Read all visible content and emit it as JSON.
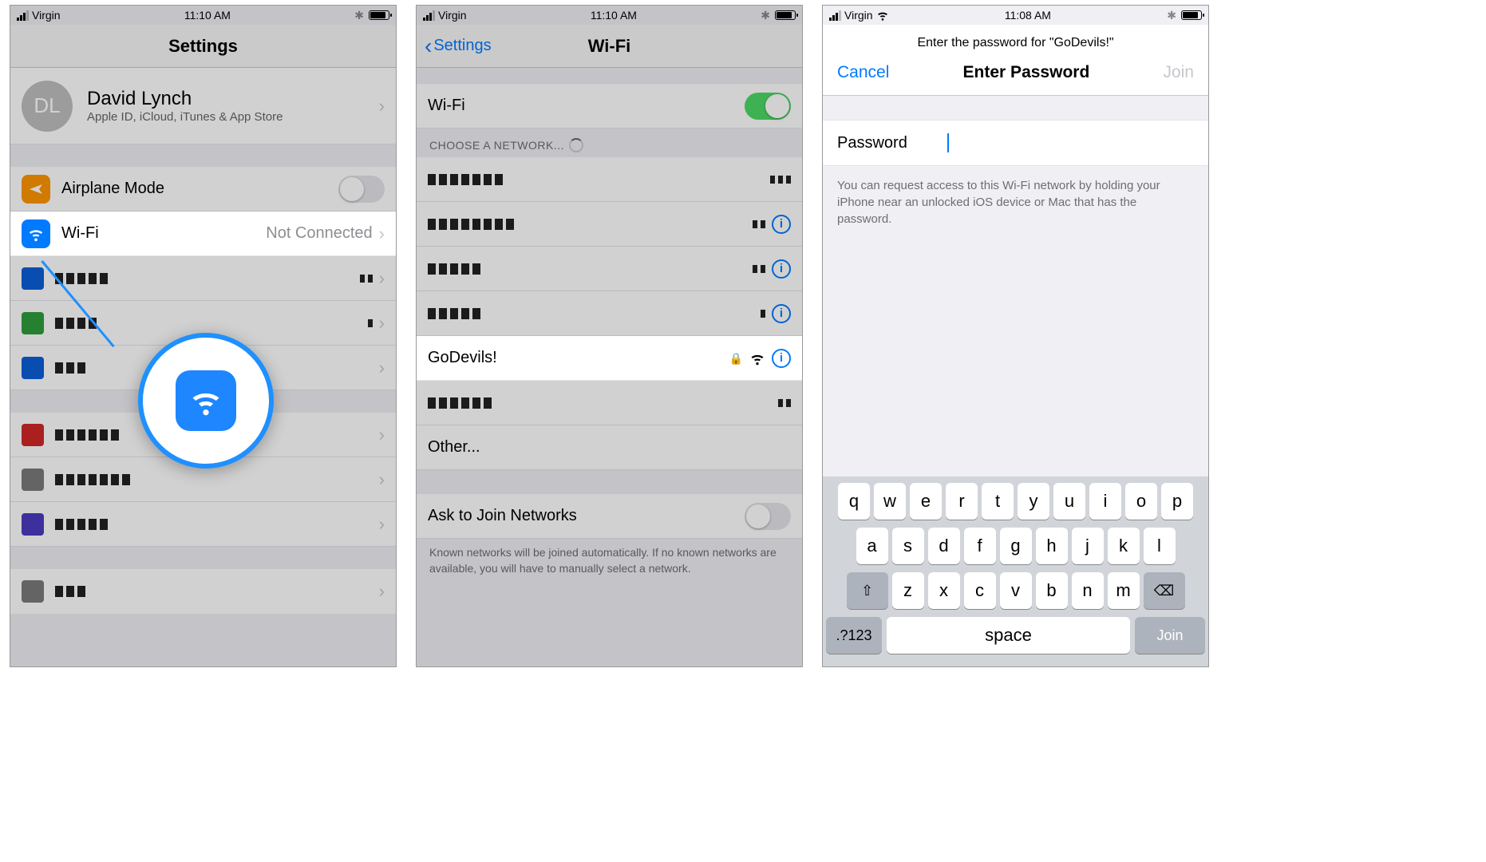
{
  "screen1": {
    "status": {
      "carrier": "Virgin",
      "time": "11:10 AM"
    },
    "title": "Settings",
    "profile": {
      "initials": "DL",
      "name": "David Lynch",
      "sub": "Apple ID, iCloud, iTunes & App Store"
    },
    "airplane": "Airplane Mode",
    "wifi": {
      "label": "Wi-Fi",
      "status": "Not Connected"
    }
  },
  "screen2": {
    "status": {
      "carrier": "Virgin",
      "time": "11:10 AM"
    },
    "back": "Settings",
    "title": "Wi-Fi",
    "wifiRow": "Wi-Fi",
    "chooseHeader": "CHOOSE A NETWORK...",
    "highlightedNetwork": "GoDevils!",
    "other": "Other...",
    "askJoin": "Ask to Join Networks",
    "footer": "Known networks will be joined automatically. If no known networks are available, you will have to manually select a network."
  },
  "screen3": {
    "status": {
      "carrier": "Virgin",
      "time": "11:08 AM"
    },
    "message": "Enter the password for \"GoDevils!\"",
    "cancel": "Cancel",
    "title": "Enter Password",
    "join": "Join",
    "pwLabel": "Password",
    "hint": "You can request access to this Wi-Fi network by holding your iPhone near an unlocked iOS device or Mac that has the password.",
    "kbd": {
      "r1": [
        "q",
        "w",
        "e",
        "r",
        "t",
        "y",
        "u",
        "i",
        "o",
        "p"
      ],
      "r2": [
        "a",
        "s",
        "d",
        "f",
        "g",
        "h",
        "j",
        "k",
        "l"
      ],
      "r3": [
        "z",
        "x",
        "c",
        "v",
        "b",
        "n",
        "m"
      ],
      "numKey": ".?123",
      "space": "space",
      "joinKey": "Join"
    }
  }
}
